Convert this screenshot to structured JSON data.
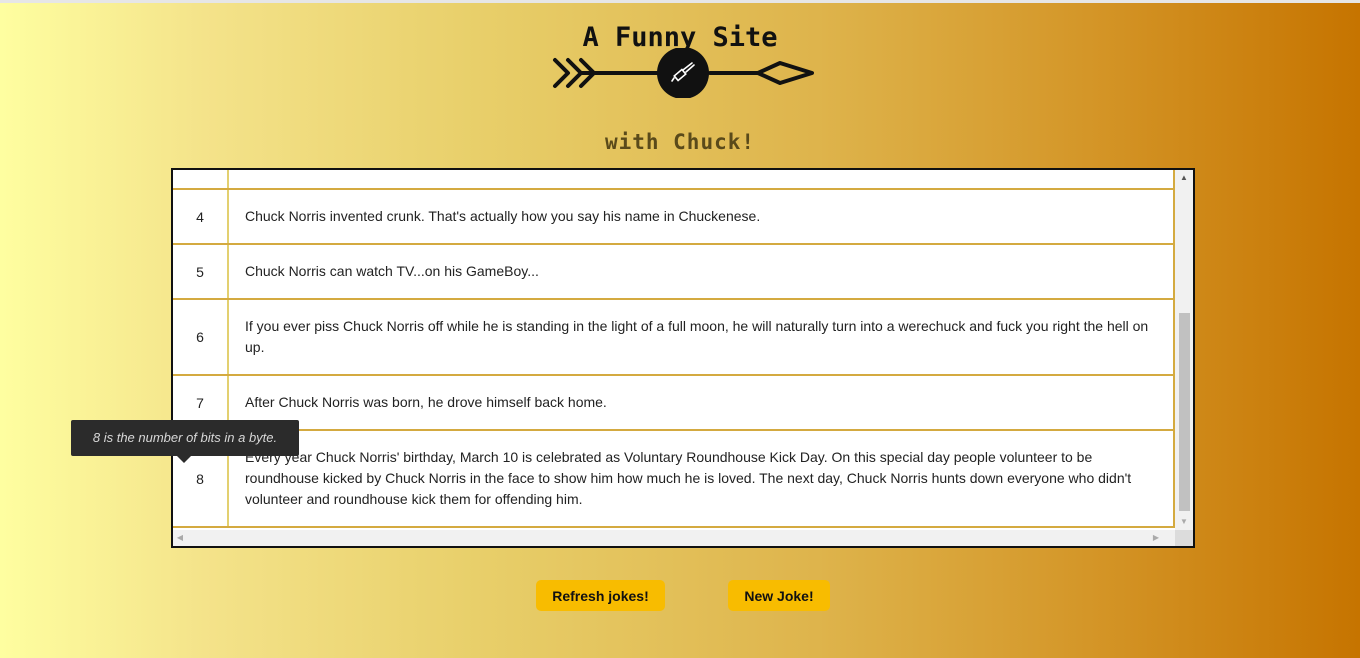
{
  "header": {
    "title": "A Funny Site",
    "subtitle": "with Chuck!",
    "logo_icon": "arrow-with-chainsaw-icon"
  },
  "jokes_table": {
    "rows": [
      {
        "id": "",
        "text": ""
      },
      {
        "id": "4",
        "text": "Chuck Norris invented crunk. That's actually how you say his name in Chuckenese."
      },
      {
        "id": "5",
        "text": "Chuck Norris can watch TV...on his GameBoy..."
      },
      {
        "id": "6",
        "text": "If you ever piss Chuck Norris off while he is standing in the light of a full moon, he will naturally turn into a werechuck and fuck you right the hell on up."
      },
      {
        "id": "7",
        "text": "After Chuck Norris was born, he drove himself back home."
      },
      {
        "id": "8",
        "text": "Every year Chuck Norris' birthday, March 10 is celebrated as Voluntary Roundhouse Kick Day. On this special day people volunteer to be roundhouse kicked by Chuck Norris in the face to show him how much he is loved. The next day, Chuck Norris hunts down everyone who didn't volunteer and roundhouse kick them for offending him."
      }
    ]
  },
  "tooltip": {
    "text": "8 is the number of bits in a byte."
  },
  "buttons": {
    "refresh_label": "Refresh jokes!",
    "new_label": "New Joke!"
  },
  "colors": {
    "button_bg": "#f8bc00",
    "row_border": "#d4aa40",
    "gradient_start": "#fefea0",
    "gradient_end": "#c67400"
  }
}
